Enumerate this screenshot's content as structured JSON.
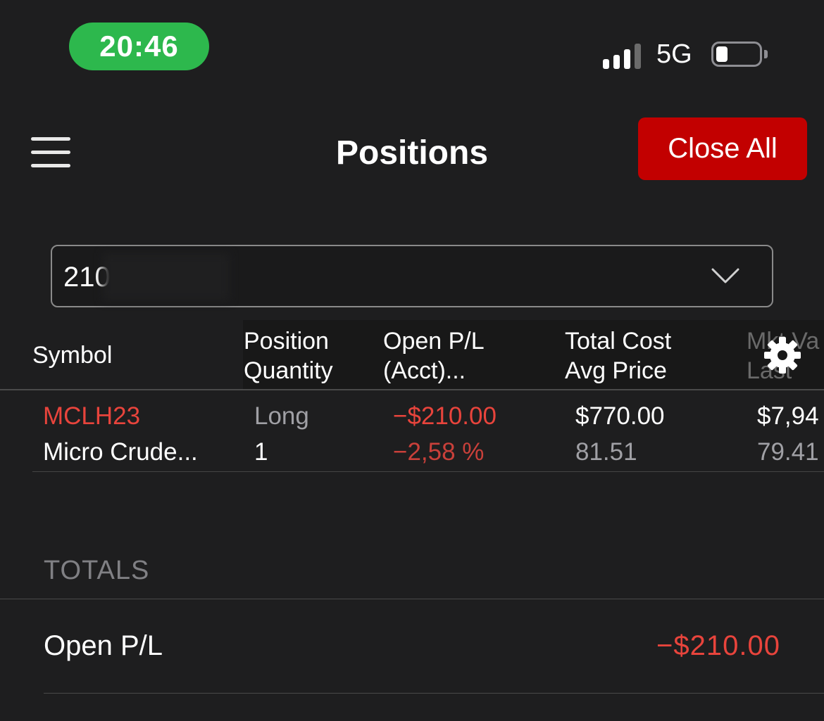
{
  "status_bar": {
    "time": "20:46",
    "network": "5G",
    "signal_icon": "signal-bars-icon",
    "battery_icon": "battery-icon"
  },
  "header": {
    "menu_icon": "hamburger-menu-icon",
    "title": "Positions",
    "close_all_label": "Close All"
  },
  "account_selector": {
    "value": "210",
    "dropdown_icon": "chevron-down-icon"
  },
  "table": {
    "columns": [
      {
        "line1": "Symbol",
        "line2": ""
      },
      {
        "line1": "Position",
        "line2": "Quantity"
      },
      {
        "line1": "Open P/L",
        "line2": "(Acct)..."
      },
      {
        "line1": "Total Cost",
        "line2": "Avg Price"
      },
      {
        "line1": "Mkt Va",
        "line2": "Last"
      }
    ],
    "settings_icon": "gear-icon",
    "rows": [
      {
        "symbol": "MCLH23",
        "description": "Micro Crude...",
        "position": "Long",
        "quantity": "1",
        "open_pl": "−$210.00",
        "open_pl_pct": "−2,58 %",
        "total_cost": "$770.00",
        "avg_price": "81.51",
        "mkt_value": "$7,94",
        "last": "79.41"
      }
    ]
  },
  "totals": {
    "section_label": "TOTALS",
    "open_pl_label": "Open P/L",
    "open_pl_value": "−$210.00"
  },
  "colors": {
    "background": "#1e1e1f",
    "time_pill": "#2db84d",
    "close_all": "#c20000",
    "negative": "#e8443c"
  }
}
